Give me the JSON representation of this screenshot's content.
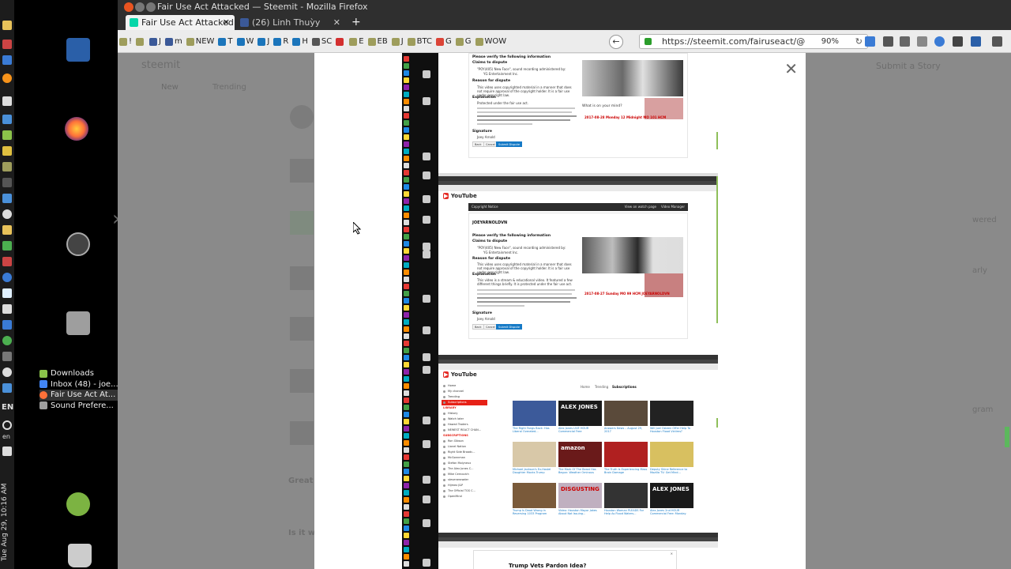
{
  "os": {
    "clock": "Tue Aug 29, 10:16 AM",
    "language": "EN",
    "language_sub": "en"
  },
  "dock": {
    "open_windows": [
      {
        "label": "Downloads",
        "color": "#8bc34a"
      },
      {
        "label": "Inbox (48) - joe...",
        "color": "#4285f4"
      },
      {
        "label": "Fair Use Act At...",
        "color": "#ff7139"
      },
      {
        "label": "Sound Prefere...",
        "color": "#9e9e9e"
      }
    ]
  },
  "window": {
    "title": "Fair Use Act Attacked — Steemit - Mozilla Firefox"
  },
  "tabs": [
    {
      "label": "Fair Use Act Attacked",
      "active": true,
      "fav_color": "#06d6a9"
    },
    {
      "label": "(26) Linh Thuỳy",
      "active": false,
      "fav_color": "#3b5998"
    }
  ],
  "bookmarks": [
    {
      "label": "!",
      "color": "#9e9d5c"
    },
    {
      "label": "",
      "color": "#9e9d5c"
    },
    {
      "label": "J",
      "color": "#3b5998"
    },
    {
      "label": "m",
      "color": "#3b5998"
    },
    {
      "label": "NEW",
      "color": "#9e9d5c"
    },
    {
      "label": "T",
      "color": "#1b75bb"
    },
    {
      "label": "W",
      "color": "#1b75bb"
    },
    {
      "label": "J",
      "color": "#1b75bb"
    },
    {
      "label": "R",
      "color": "#1b75bb"
    },
    {
      "label": "H",
      "color": "#1b75bb"
    },
    {
      "label": "SC",
      "color": "#555555"
    },
    {
      "label": "",
      "color": "#d32f2f"
    },
    {
      "label": "E",
      "color": "#9e9d5c"
    },
    {
      "label": "EB",
      "color": "#9e9d5c"
    },
    {
      "label": "J",
      "color": "#9e9d5c"
    },
    {
      "label": "BTC",
      "color": "#9e9d5c"
    },
    {
      "label": "G",
      "color": "#db4437"
    },
    {
      "label": "G",
      "color": "#9e9d5c"
    },
    {
      "label": "WOW",
      "color": "#9e9d5c"
    }
  ],
  "url": {
    "text": "https://steemit.com/fairuseact/@",
    "zoom": "90%"
  },
  "background_page": {
    "site": "steemit",
    "tab_new": "New",
    "trending": "Trending",
    "submit": "Submit a Story",
    "comment1": "Great",
    "comment2": "Is it w",
    "side1": "wered",
    "side2": "arly",
    "side3": "gram"
  },
  "screenshot_content": {
    "section1": {
      "verify": "Please verify the following information",
      "claims": "Claims to dispute",
      "claim_item": "\"POY(405) New Face\", sound recording administered by:",
      "claim_org": "YG Entertainment Inc.",
      "reason_h": "Reason for dispute",
      "reason_t": "This video uses copyrighted material in a manner that does not require approval of the copyright holder. It is a fair use under copyright law.",
      "explanation": "Explanation",
      "expl_t": "Protected under the fair use act.",
      "signature": "Signature",
      "signer": "Joey Arnold",
      "back": "Back",
      "cancel": "Cancel",
      "submit": "Submit Dispute",
      "what_mood": "What is on your mind?",
      "date_line": "2017-08-28 Monday 12 Midnight MO 101 HCM"
    },
    "section2": {
      "youtube": "YouTube",
      "notice": "Copyright Notice",
      "view_on_watch": "View on watch page",
      "video_manager": "Video Manager",
      "channel": "JOEYARNOLDVN",
      "verify": "Please verify the following information",
      "claims": "Claims to dispute",
      "claim_item": "\"POY(405) New Face\", sound recording administered by:",
      "claim_org": "YG Entertainment Inc.",
      "reason_h": "Reason for dispute",
      "reason_t": "This video uses copyrighted material in a manner that does not require approval of the copyright holder. It is a fair use under copyright law.",
      "explanation": "Explanation",
      "expl_t": "This video is a stream & educational video. It featured a few different things briefly. It is protected under the fair use act.",
      "signature": "Signature",
      "signer": "Joey Arnold",
      "back": "Back",
      "cancel": "Cancel",
      "submit": "Submit Dispute",
      "date_line": "2017-08-27 Sunday MO 99 HCM JOEYARNOLDVN"
    },
    "section3": {
      "youtube": "YouTube",
      "nav": [
        "Home",
        "Trending",
        "Subscriptions"
      ],
      "sidebar": [
        "Home",
        "My channel",
        "Trending",
        "Subscriptions"
      ],
      "library": "LIBRARY",
      "library_items": [
        "History",
        "Watch later",
        "Hawaii Traders",
        "NEWEST REACT CHAN..."
      ],
      "subs_h": "SUBSCRIPTIONS",
      "subs": [
        "Ron Gibson",
        "Lionel Nation",
        "Right Side Broadc...",
        "McGonnman",
        "Stefan Molyneux",
        "The Alex Jones C...",
        "Mike Cernovich",
        "stevenerowder",
        "Hijmex J&P",
        "The Official TGS C...",
        "OpenMind"
      ],
      "videos": [
        {
          "title": "The Right Fangs Back: Has Liberal Overated...",
          "color": "#3c5a9a"
        },
        {
          "title": "Alex Jones LIVE HOUR Commercial Free",
          "color": "#1a1a1a",
          "overlay": "ALEX JONES"
        },
        {
          "title": "Answers News – August 29, 2017",
          "color": "#5a4a3a"
        },
        {
          "title": "Will Joel Osteen Offer Help To Houston Flood Victims?",
          "color": "#222"
        },
        {
          "title": "Michael Jackson's Ex-Hostel Daughter Mocks Trump",
          "color": "#d8c8a8"
        },
        {
          "title": "The Mark Of The Beast Has Begun: Weather Ominous",
          "color": "#6a1a1a",
          "overlay": "amazon"
        },
        {
          "title": "The Truth Is Experiencing Mass Brain Damage",
          "color": "#b02020"
        },
        {
          "title": "Deputy Shine Reference to Mozilla TV: Get Mind...",
          "color": "#d8c060"
        },
        {
          "title": "Trump Is Dead Wrong in Reversing 1033 Program",
          "color": "#7a5a3a"
        },
        {
          "title": "Video: Houston Mayor Jokes About Not Issuing...",
          "color": "#c0b0c0",
          "overlay": "DISGUSTING"
        },
        {
          "title": "Houston Woman PLEADS For Help As Flood Waters...",
          "color": "#333"
        },
        {
          "title": "Alex Jones 2nd HOUR Commercial Free: Monday",
          "color": "#1a1a1a",
          "overlay": "ALEX JONES"
        }
      ],
      "section4_title": "Trump Vets Pardon Idea?"
    }
  },
  "colors": {
    "accent_green": "#5cb85c",
    "youtube_red": "#e52d27",
    "youtube_blue": "#167ac6"
  }
}
